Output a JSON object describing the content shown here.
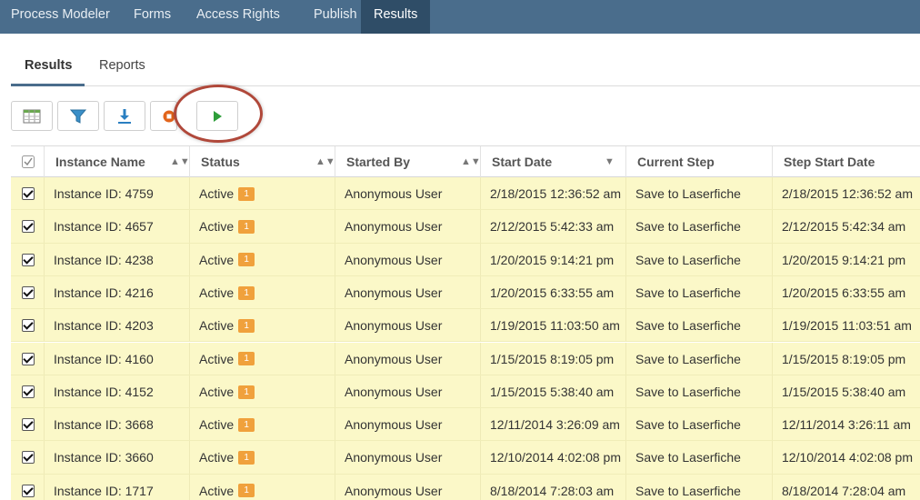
{
  "topnav": {
    "items": [
      {
        "label": "Process Modeler"
      },
      {
        "label": "Forms"
      },
      {
        "label": "Access Rights"
      },
      {
        "label": "Publish"
      },
      {
        "label": "Results"
      }
    ],
    "active": "Results"
  },
  "subtabs": {
    "items": [
      {
        "label": "Results"
      },
      {
        "label": "Reports"
      }
    ],
    "active": "Results"
  },
  "toolbar": {
    "buttons": [
      {
        "icon": "columns-icon"
      },
      {
        "icon": "filter-icon"
      },
      {
        "icon": "download-icon"
      },
      {
        "icon": "stop-icon"
      },
      {
        "icon": "play-icon"
      }
    ]
  },
  "colors": {
    "nav_bg": "#4a6d8c",
    "nav_active_bg": "#2f4d67",
    "row_highlight": "#fbf8c8",
    "badge": "#f0a13c",
    "play_green": "#2e9e3a",
    "stop_orange": "#e2641b",
    "annotation_red": "#b0483a"
  },
  "table": {
    "headers": [
      "Instance Name",
      "Status",
      "Started By",
      "Start Date",
      "Current Step",
      "Step Start Date"
    ],
    "rows": [
      {
        "name": "Instance ID: 4759",
        "status": "Active",
        "badge": "1",
        "started_by": "Anonymous User",
        "start_date": "2/18/2015 12:36:52 am",
        "current_step": "Save to Laserfiche",
        "step_start": "2/18/2015 12:36:52 am"
      },
      {
        "name": "Instance ID: 4657",
        "status": "Active",
        "badge": "1",
        "started_by": "Anonymous User",
        "start_date": "2/12/2015 5:42:33 am",
        "current_step": "Save to Laserfiche",
        "step_start": "2/12/2015 5:42:34 am"
      },
      {
        "name": "Instance ID: 4238",
        "status": "Active",
        "badge": "1",
        "started_by": "Anonymous User",
        "start_date": "1/20/2015 9:14:21 pm",
        "current_step": "Save to Laserfiche",
        "step_start": "1/20/2015 9:14:21 pm"
      },
      {
        "name": "Instance ID: 4216",
        "status": "Active",
        "badge": "1",
        "started_by": "Anonymous User",
        "start_date": "1/20/2015 6:33:55 am",
        "current_step": "Save to Laserfiche",
        "step_start": "1/20/2015 6:33:55 am"
      },
      {
        "name": "Instance ID: 4203",
        "status": "Active",
        "badge": "1",
        "started_by": "Anonymous User",
        "start_date": "1/19/2015 11:03:50 am",
        "current_step": "Save to Laserfiche",
        "step_start": "1/19/2015 11:03:51 am"
      },
      {
        "name": "Instance ID: 4160",
        "status": "Active",
        "badge": "1",
        "started_by": "Anonymous User",
        "start_date": "1/15/2015 8:19:05 pm",
        "current_step": "Save to Laserfiche",
        "step_start": "1/15/2015 8:19:05 pm"
      },
      {
        "name": "Instance ID: 4152",
        "status": "Active",
        "badge": "1",
        "started_by": "Anonymous User",
        "start_date": "1/15/2015 5:38:40 am",
        "current_step": "Save to Laserfiche",
        "step_start": "1/15/2015 5:38:40 am"
      },
      {
        "name": "Instance ID: 3668",
        "status": "Active",
        "badge": "1",
        "started_by": "Anonymous User",
        "start_date": "12/11/2014 3:26:09 am",
        "current_step": "Save to Laserfiche",
        "step_start": "12/11/2014 3:26:11 am"
      },
      {
        "name": "Instance ID: 3660",
        "status": "Active",
        "badge": "1",
        "started_by": "Anonymous User",
        "start_date": "12/10/2014 4:02:08 pm",
        "current_step": "Save to Laserfiche",
        "step_start": "12/10/2014 4:02:08 pm"
      },
      {
        "name": "Instance ID: 1717",
        "status": "Active",
        "badge": "1",
        "started_by": "Anonymous User",
        "start_date": "8/18/2014 7:28:03 am",
        "current_step": "Save to Laserfiche",
        "step_start": "8/18/2014 7:28:04 am"
      }
    ]
  }
}
